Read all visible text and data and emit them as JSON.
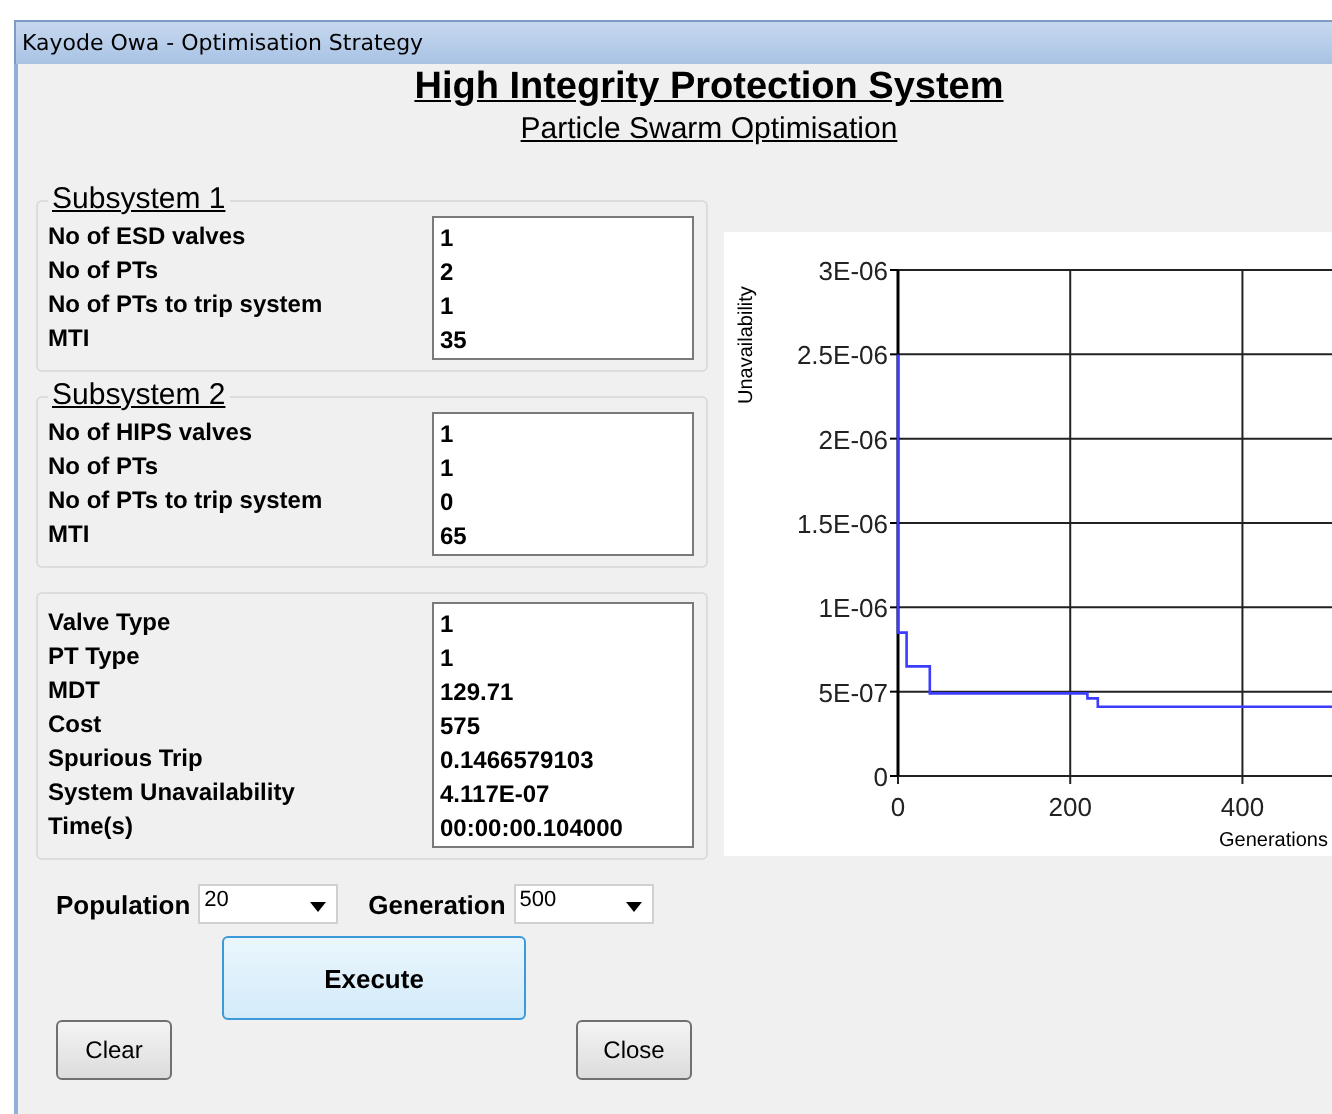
{
  "window": {
    "title": "Kayode Owa - Optimisation Strategy"
  },
  "heading": "High Integrity Protection System",
  "subheading": "Particle Swarm Optimisation",
  "groups": [
    {
      "title": "Subsystem 1",
      "rows": [
        {
          "label": "No of ESD valves",
          "value": "1"
        },
        {
          "label": "No of PTs",
          "value": "2"
        },
        {
          "label": "No of PTs to trip system",
          "value": "1"
        },
        {
          "label": "MTI",
          "value": "35"
        }
      ]
    },
    {
      "title": "Subsystem 2",
      "rows": [
        {
          "label": "No of HIPS valves",
          "value": "1"
        },
        {
          "label": "No of PTs",
          "value": "1"
        },
        {
          "label": "No of PTs to trip system",
          "value": "0"
        },
        {
          "label": "MTI",
          "value": "65"
        }
      ]
    },
    {
      "rows": [
        {
          "label": "Valve Type",
          "value": "1"
        },
        {
          "label": "PT Type",
          "value": "1"
        },
        {
          "label": "MDT",
          "value": "129.71"
        },
        {
          "label": "Cost",
          "value": "575"
        },
        {
          "label": "Spurious Trip",
          "value": "0.1466579103"
        },
        {
          "label": "System Unavailability",
          "value": "4.117E-07"
        },
        {
          "label": "Time(s)",
          "value": "00:00:00.104000"
        }
      ]
    }
  ],
  "selectors": [
    {
      "label": "Population",
      "value": "20"
    },
    {
      "label": "Generation",
      "value": "500"
    }
  ],
  "buttons": [
    {
      "label": "Clear",
      "kind": "normal"
    },
    {
      "label": "Execute",
      "kind": "primary"
    },
    {
      "label": "Close",
      "kind": "normal"
    }
  ],
  "chart": {
    "chart_data": {
      "type": "line",
      "grid": true,
      "xlabel": "Generations",
      "ylabel": "Unavailability",
      "xlim": [
        0,
        504
      ],
      "ylim": [
        0,
        3e-06
      ],
      "xticks": [
        0,
        200,
        400
      ],
      "yticks": [
        {
          "value": 0,
          "label": "0"
        },
        {
          "value": 5e-07,
          "label": "5E-07"
        },
        {
          "value": 1e-06,
          "label": "1E-06"
        },
        {
          "value": 1.5e-06,
          "label": "1.5E-06"
        },
        {
          "value": 2e-06,
          "label": "2E-06"
        },
        {
          "value": 2.5e-06,
          "label": "2.5E-06"
        },
        {
          "value": 3e-06,
          "label": "3E-06"
        }
      ],
      "x": [
        0,
        0,
        10,
        10,
        37,
        37,
        220,
        220,
        232,
        232,
        504
      ],
      "series": [
        {
          "color": "#3c3cff",
          "values": [
            2.5e-06,
            8.5e-07,
            8.5e-07,
            6.5e-07,
            6.5e-07,
            4.9e-07,
            4.9e-07,
            4.6e-07,
            4.6e-07,
            4.1e-07,
            4.1e-07
          ]
        }
      ]
    }
  }
}
